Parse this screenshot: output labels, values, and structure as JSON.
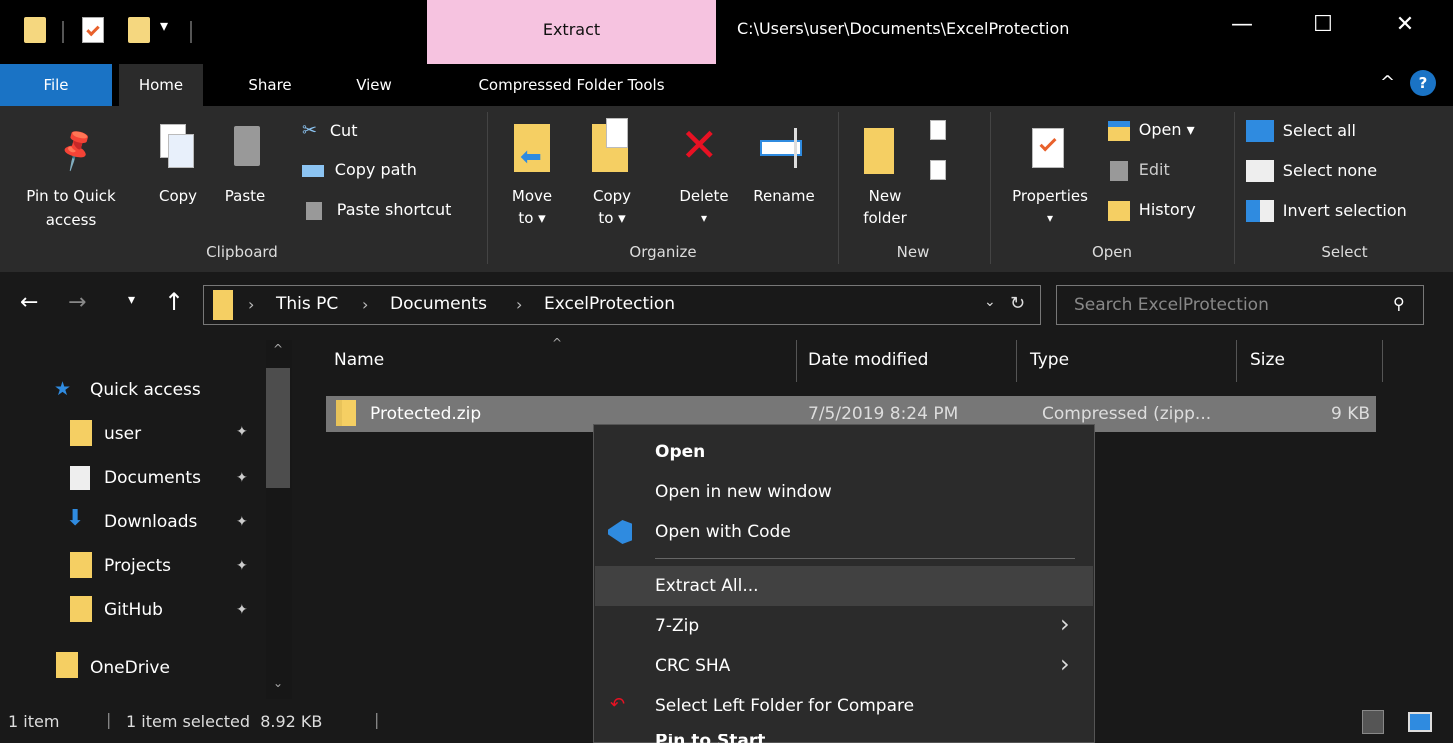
{
  "titlebar": {
    "context_tab": "Extract",
    "path": "C:\\Users\\user\\Documents\\ExcelProtection",
    "minimize": "—",
    "maximize": "☐",
    "close": "✕"
  },
  "tabs": {
    "file": "File",
    "home": "Home",
    "share": "Share",
    "view": "View",
    "compressed": "Compressed Folder Tools"
  },
  "ribbon": {
    "pin_line1": "Pin to Quick",
    "pin_line2": "access",
    "copy": "Copy",
    "paste": "Paste",
    "cut": "Cut",
    "copy_path": "Copy path",
    "paste_shortcut": "Paste shortcut",
    "clipboard": "Clipboard",
    "move_to_1": "Move",
    "move_to_2": "to ▾",
    "copy_to_1": "Copy",
    "copy_to_2": "to ▾",
    "delete": "Delete",
    "delete_arrow": "▾",
    "rename": "Rename",
    "organize": "Organize",
    "new_folder_1": "New",
    "new_folder_2": "folder",
    "new": "New",
    "properties": "Properties",
    "properties_arrow": "▾",
    "open_btn": "Open ▾",
    "edit": "Edit",
    "history": "History",
    "open": "Open",
    "select_all": "Select all",
    "select_none": "Select none",
    "invert_selection": "Invert selection",
    "select": "Select"
  },
  "address": {
    "crumbs": [
      "This PC",
      "Documents",
      "ExcelProtection"
    ],
    "sep": "›",
    "search_placeholder": "Search ExcelProtection"
  },
  "nav": {
    "quick_access": "Quick access",
    "items": [
      "user",
      "Documents",
      "Downloads",
      "Projects",
      "GitHub"
    ],
    "onedrive": "OneDrive"
  },
  "columns": {
    "name": "Name",
    "date": "Date modified",
    "type": "Type",
    "size": "Size"
  },
  "files": [
    {
      "name": "Protected.zip",
      "date": "7/5/2019 8:24 PM",
      "type": "Compressed (zipp...",
      "size": "9 KB"
    }
  ],
  "context_menu": {
    "open": "Open",
    "open_new_window": "Open in new window",
    "open_with_code": "Open with Code",
    "extract_all": "Extract All...",
    "seven_zip": "7-Zip",
    "crc_sha": "CRC SHA",
    "select_left": "Select Left Folder for Compare",
    "pin_to_start": "Pin to Start"
  },
  "status": {
    "items": "1 item",
    "selected": "1 item selected  8.92 KB"
  },
  "colors": {
    "accent_file_tab": "#1a73c5",
    "context_tab": "#f6c3e0",
    "folder": "#f5cf63",
    "delete_red": "#e81123"
  }
}
